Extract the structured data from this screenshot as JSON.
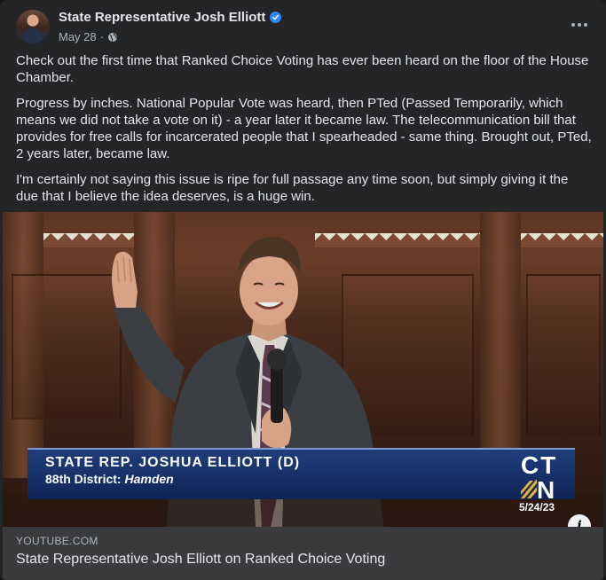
{
  "post": {
    "author": "State Representative Josh Elliott",
    "date": "May 28",
    "separator": "·",
    "icons": {
      "verified": "verified-badge-icon",
      "audience": "globe-icon",
      "more": "more-options-icon",
      "info": "info-icon"
    },
    "paragraphs": [
      "Check out the first time that Ranked Choice Voting has ever been heard on the floor of the House Chamber.",
      "Progress by inches. National Popular Vote was heard, then PTed (Passed Temporarily, which means we did not take a vote on it) - a year later it became law. The telecommunication bill that provides for free calls for incarcerated people that I spearheaded - same thing. Brought out, PTed, 2 years later, became law.",
      "I'm certainly not saying this issue is ripe for full passage any time soon, but simply giving it the due that I believe the idea deserves, is a huge win."
    ]
  },
  "video": {
    "lower_third_name": "STATE REP. JOSHUA ELLIOTT (D)",
    "lower_third_district": "88th District:",
    "lower_third_town": "Hamden",
    "network_top": "CT",
    "network_bottom": "N",
    "broadcast_date": "5/24/23",
    "info_glyph": "i"
  },
  "link": {
    "domain": "YOUTUBE.COM",
    "title": "State Representative Josh Elliott on Ranked Choice Voting"
  },
  "colors": {
    "background": "#242526",
    "text_primary": "#e4e6eb",
    "text_secondary": "#b0b3b8",
    "verified_blue": "#2d88ff",
    "link_card": "#3a3b3c",
    "lower_third_blue": "#17326a",
    "ctn_gold": "#e2b33b"
  }
}
